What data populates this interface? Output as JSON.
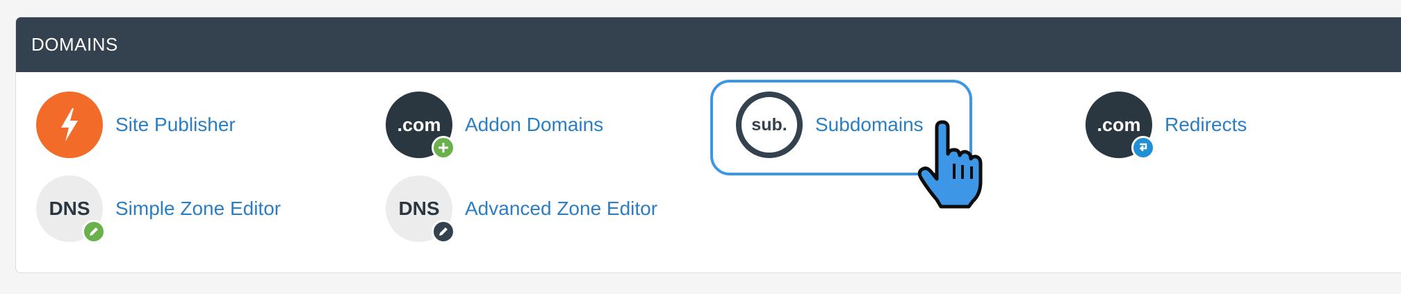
{
  "panel": {
    "title": "DOMAINS"
  },
  "items": [
    {
      "label": "Site Publisher",
      "icon": "lightning-bolt-icon",
      "color": "#f26b29"
    },
    {
      "label": "Addon Domains",
      "icon_text": ".com",
      "badge": "plus-icon",
      "badge_color": "#6ab04c"
    },
    {
      "label": "Subdomains",
      "icon_text": "sub.",
      "highlighted": true
    },
    {
      "label": "Redirects",
      "icon_text": ".com",
      "badge": "redirect-arrow-icon",
      "badge_color": "#1f8fd6"
    },
    {
      "label": "Simple Zone Editor",
      "icon_text": "DNS",
      "badge": "pencil-icon",
      "badge_color": "#6ab04c"
    },
    {
      "label": "Advanced Zone Editor",
      "icon_text": "DNS",
      "badge": "pencil-icon",
      "badge_color": "#34414f"
    }
  ],
  "colors": {
    "header_bg": "#34414f",
    "link": "#2b7ec4",
    "highlight": "#3d96e6",
    "cursor": "#3d96e6"
  },
  "cursor": "hand-pointer-icon"
}
